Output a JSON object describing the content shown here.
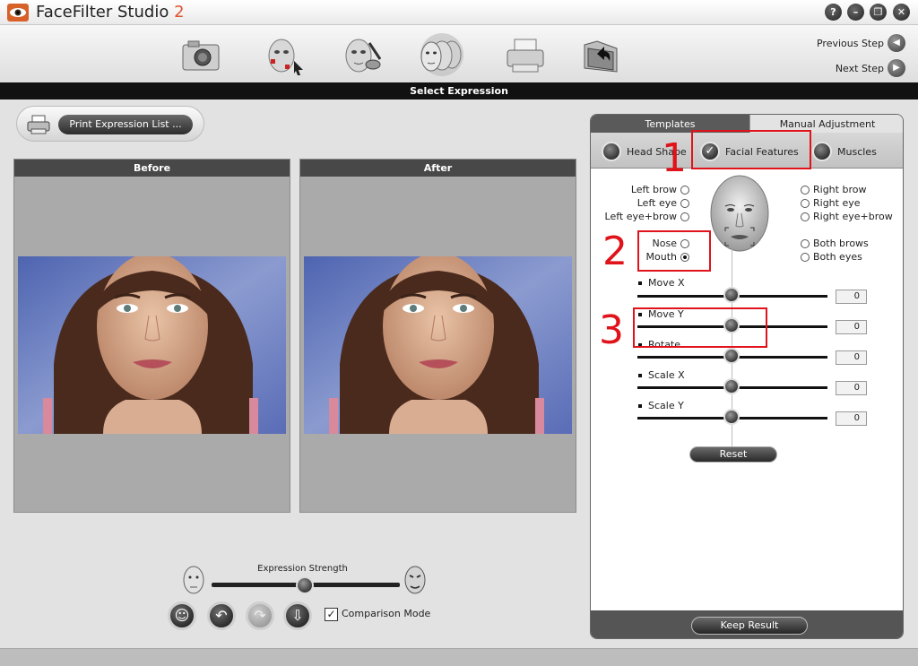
{
  "app": {
    "title_main": "FaceFilter Studio",
    "title_version": "2"
  },
  "window_controls": [
    "?",
    "–",
    "❐",
    "✕"
  ],
  "toolbar": {
    "tools": [
      "camera-icon",
      "face-select-icon",
      "face-edit-icon",
      "expression-faces-icon",
      "printer-icon",
      "folder-icon"
    ],
    "previous_label": "Previous Step",
    "next_label": "Next Step"
  },
  "step_title": "Select Expression",
  "print_button_label": "Print Expression List ...",
  "before_label": "Before",
  "after_label": "After",
  "strength": {
    "label": "Expression Strength",
    "value": 0.5
  },
  "comparison": {
    "label": "Comparison Mode",
    "checked": true,
    "mark": "✓"
  },
  "bottom_buttons": [
    "☺",
    "↶",
    "↷",
    "⇩"
  ],
  "panel": {
    "tabs": {
      "templates": "Templates",
      "manual": "Manual Adjustment"
    },
    "subtabs": {
      "head_shape": "Head Shape",
      "facial_features": "Facial Features",
      "muscles": "Muscles",
      "check": "✓"
    },
    "features_left": [
      "Left brow",
      "Left eye",
      "Left eye+brow",
      "Nose",
      "Mouth"
    ],
    "features_right": [
      "Right brow",
      "Right eye",
      "Right eye+brow",
      "Both brows",
      "Both eyes"
    ],
    "selected_feature": "Mouth",
    "sliders": [
      {
        "label": "Move X",
        "value": "0"
      },
      {
        "label": "Move Y",
        "value": "0"
      },
      {
        "label": "Rotate",
        "value": "0"
      },
      {
        "label": "Scale X",
        "value": "0"
      },
      {
        "label": "Scale Y",
        "value": "0"
      }
    ],
    "reset_label": "Reset",
    "keep_label": "Keep Result"
  },
  "annotations": [
    "1",
    "2",
    "3"
  ],
  "colors": {
    "annotation": "#e0131a",
    "accent_version": "#e0522e",
    "step_bar": "#111111"
  }
}
